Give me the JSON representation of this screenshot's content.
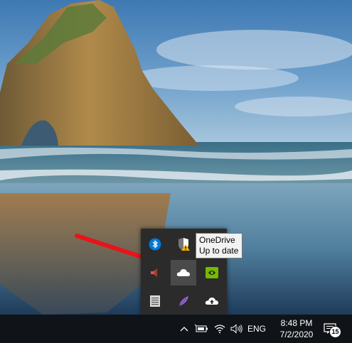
{
  "tray_flyout": {
    "icons": [
      "bluetooth-icon",
      "windows-security-warning-icon",
      "speaker-icon",
      "onedrive-icon",
      "nvidia-icon",
      "keyboard-icon",
      "feather-icon",
      "cloud-upload-icon"
    ]
  },
  "tooltip": {
    "title": "OneDrive",
    "status": "Up to date"
  },
  "taskbar": {
    "language": "ENG",
    "time": "8:48 PM",
    "date": "7/2/2020",
    "notification_count": "15",
    "icons": [
      "chevron-up-icon",
      "battery-power-icon",
      "wifi-icon",
      "volume-icon",
      "action-center-icon"
    ]
  },
  "colors": {
    "taskbar_bg": "#101318",
    "flyout_bg": "#2b2b2b",
    "arrow": "#e8141a"
  }
}
